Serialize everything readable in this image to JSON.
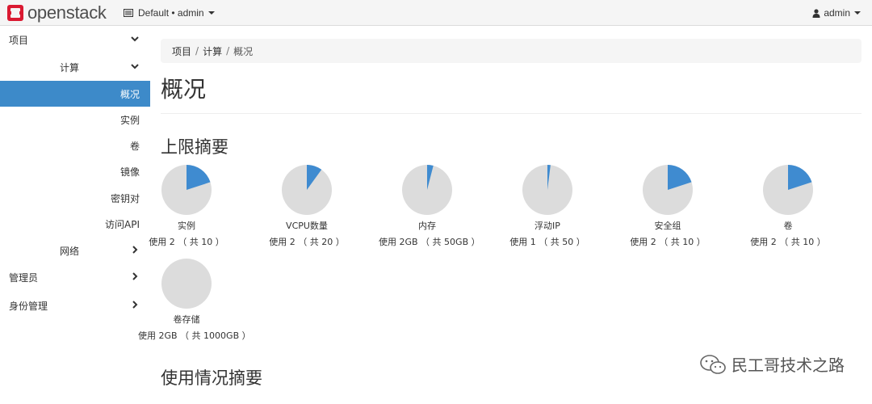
{
  "header": {
    "logo_text": "openstack",
    "project_selector": "Default • admin",
    "user": "admin"
  },
  "sidebar": {
    "project": "项目",
    "compute": "计算",
    "compute_items": [
      "概况",
      "实例",
      "卷",
      "镜像",
      "密钥对",
      "访问API"
    ],
    "network": "网络",
    "admin": "管理员",
    "identity": "身份管理"
  },
  "breadcrumb": [
    "项目",
    "计算",
    "概况"
  ],
  "page_title": "概况",
  "limits": {
    "title": "上限摘要",
    "charts": [
      {
        "label": "实例",
        "usage": "使用 2 （ 共 10 ）",
        "fraction": 0.2
      },
      {
        "label": "VCPU数量",
        "usage": "使用 2 （ 共 20 ）",
        "fraction": 0.1
      },
      {
        "label": "内存",
        "usage": "使用 2GB （ 共 50GB ）",
        "fraction": 0.04
      },
      {
        "label": "浮动IP",
        "usage": "使用 1 （ 共 50 ）",
        "fraction": 0.02
      },
      {
        "label": "安全组",
        "usage": "使用 2 （ 共 10 ）",
        "fraction": 0.2
      },
      {
        "label": "卷",
        "usage": "使用 2 （ 共 10 ）",
        "fraction": 0.2
      },
      {
        "label": "卷存储",
        "usage": "使用 2GB （ 共 1000GB ）",
        "fraction": 0.002
      }
    ]
  },
  "usage_summary_title": "使用情况摘要",
  "watermark": "民工哥技术之路",
  "colors": {
    "accent": "#3d8ac9",
    "pie_used": "#3f8bd0",
    "pie_free": "#dcdcdc"
  }
}
